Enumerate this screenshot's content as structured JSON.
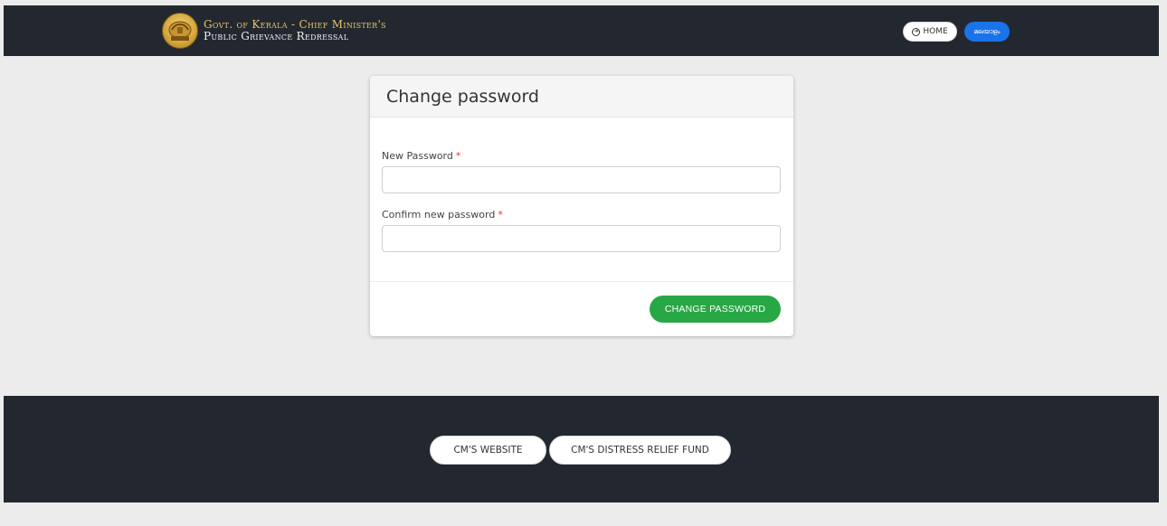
{
  "header": {
    "brand_line1": "Govt. of Kerala -  Chief Minister's",
    "brand_line2": "Public Grievance Redressal",
    "home_label": "HOME",
    "lang_label": "മലയാളം"
  },
  "card": {
    "title": "Change password",
    "new_password_label": "New Password",
    "confirm_password_label": "Confirm new password",
    "required_mark": "*",
    "submit_label": "CHANGE PASSWORD"
  },
  "footer": {
    "cm_website_label": "CM'S WEBSITE",
    "relief_fund_label": "CM'S DISTRESS RELIEF FUND"
  },
  "colors": {
    "header_bg": "#232830",
    "accent_gold": "#e9c46a",
    "lang_button": "#1a73e8",
    "submit_button": "#28a745",
    "required": "#e53935"
  },
  "icons": {
    "emblem": "kerala-emblem-icon",
    "home": "circle-arrow-icon"
  }
}
